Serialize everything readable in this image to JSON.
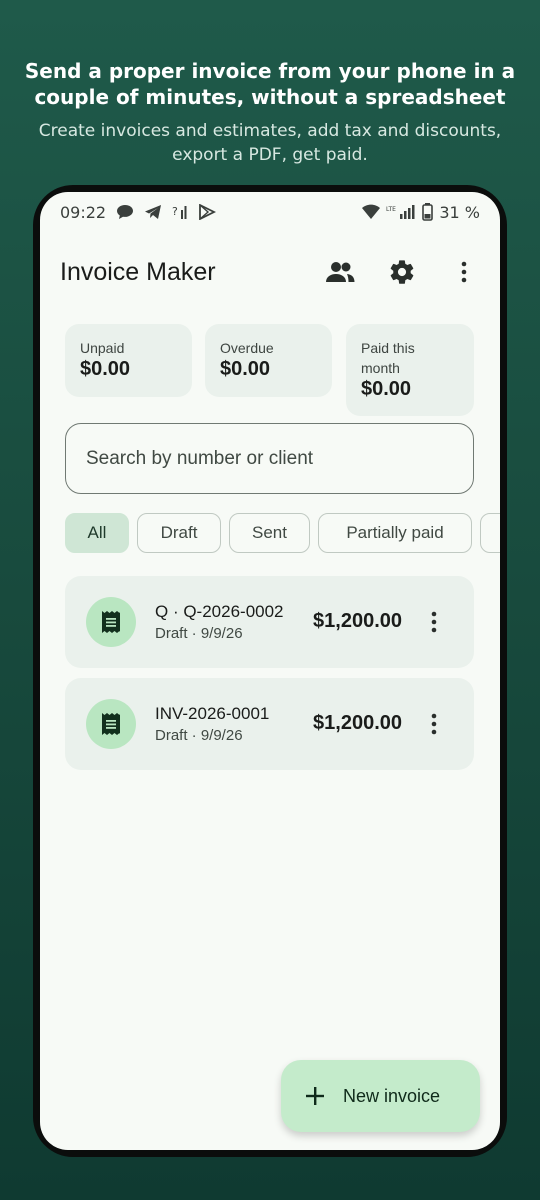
{
  "promo": {
    "title": "Send a proper invoice from your phone in a couple of minutes, without a spreadsheet and",
    "subtitle": "Create invoices and estimates, add tax and discounts, export a PDF, get paid."
  },
  "status_bar": {
    "time": "09:22",
    "battery": "31 %",
    "network": "LTE"
  },
  "app": {
    "title": "Invoice Maker"
  },
  "summary": {
    "unpaid_label": "Unpaid",
    "unpaid_value": "$0.00",
    "overdue_label": "Overdue",
    "overdue_value": "$0.00",
    "paid_label": "Paid this month",
    "paid_value": "$0.00"
  },
  "search": {
    "placeholder": "Search by number or client"
  },
  "filters": {
    "all": "All",
    "draft": "Draft",
    "sent": "Sent",
    "partially_paid": "Partially paid",
    "selected": "All"
  },
  "invoices": [
    {
      "title": "Q · Q-2026-0002",
      "subtitle": "Draft · 9/9/26",
      "amount": "$1,200.00",
      "icon": "receipt-icon"
    },
    {
      "title": "INV-2026-0001",
      "subtitle": "Draft · 9/9/26",
      "amount": "$1,200.00",
      "icon": "receipt-icon"
    }
  ],
  "fab": {
    "label": "New invoice",
    "icon": "plus-icon"
  },
  "colors": {
    "background": "#1f5a4a",
    "surface": "#f7faf6",
    "card": "#eaf1ec",
    "accent_container": "#c4ebcb",
    "selected_chip": "#cfe6d5"
  }
}
